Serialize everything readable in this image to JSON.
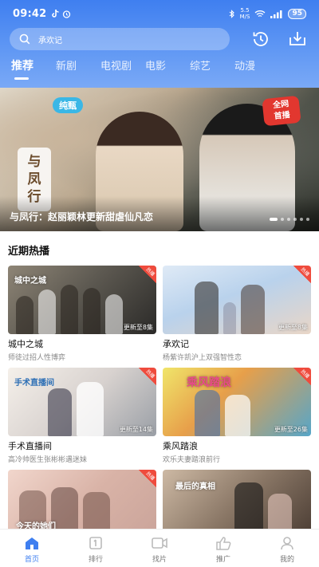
{
  "status_bar": {
    "time": "09:42",
    "net_speed_top": "5.5",
    "net_speed_unit": "M/S",
    "battery": "95"
  },
  "search": {
    "placeholder": "承欢记"
  },
  "tabs": [
    {
      "label": "推荐",
      "active": true
    },
    {
      "label": "新剧",
      "active": false
    },
    {
      "label": "电视剧",
      "active": false
    },
    {
      "label": "电影",
      "active": false
    },
    {
      "label": "综艺",
      "active": false
    },
    {
      "label": "动漫",
      "active": false
    }
  ],
  "banner": {
    "caption": "与凤行：赵丽颖林更新甜虐仙凡恋",
    "poster_title_1": "与",
    "poster_title_2": "凤",
    "poster_title_3": "行",
    "logo": "纯甄",
    "badge_line1": "全网",
    "badge_line2": "首播",
    "dot_count": 6,
    "active_dot": 0
  },
  "section": {
    "title": "近期热播"
  },
  "hot_label": "热播",
  "cards": [
    {
      "title": "城中之城",
      "desc": "师徒过招人性博弈",
      "episodes": "更新至8集",
      "poster_word": "城中之城",
      "hot": true
    },
    {
      "title": "承欢记",
      "desc": "杨紫许凯沪上双强智性恋",
      "episodes": "更新至8集",
      "poster_word": "",
      "hot": true
    },
    {
      "title": "手术直播间",
      "desc": "高冷帅医生张彬彬遇迷妹",
      "episodes": "更新至14集",
      "poster_word": "手术直播间",
      "hot": true
    },
    {
      "title": "乘风踏浪",
      "desc": "欢乐夫妻踏浪前行",
      "episodes": "更新至26集",
      "poster_word": "乘风踏浪",
      "hot": true
    },
    {
      "title": "",
      "desc": "",
      "episodes": "",
      "poster_word": "今天的她们",
      "hot": true
    },
    {
      "title": "",
      "desc": "",
      "episodes": "",
      "poster_word": "最后的真相",
      "hot": false
    }
  ],
  "bottom_nav": [
    {
      "label": "首页",
      "icon": "home-icon",
      "active": true
    },
    {
      "label": "排行",
      "icon": "ranking-icon",
      "active": false
    },
    {
      "label": "找片",
      "icon": "video-icon",
      "active": false
    },
    {
      "label": "推广",
      "icon": "thumb-up-icon",
      "active": false
    },
    {
      "label": "我的",
      "icon": "user-icon",
      "active": false
    }
  ],
  "colors": {
    "accent": "#3f7ff0",
    "hot_badge": "#ef4b3d"
  }
}
